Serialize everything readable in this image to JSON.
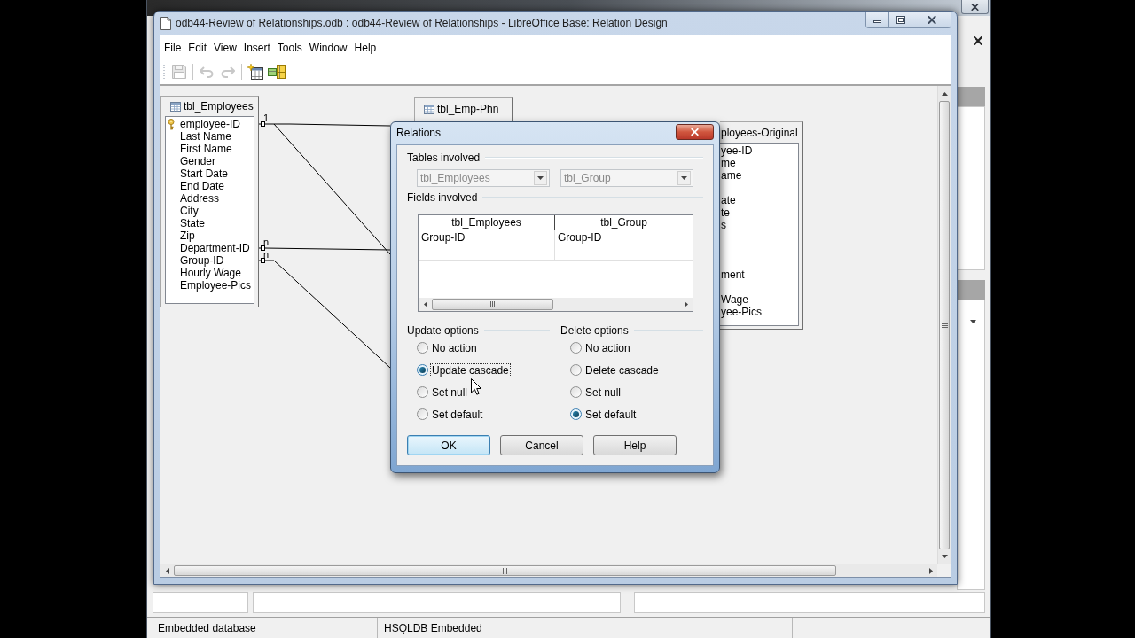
{
  "window": {
    "title": "odb44-Review of Relationships.odb : odb44-Review of Relationships - LibreOffice Base: Relation Design"
  },
  "menu": [
    {
      "label": "File"
    },
    {
      "label": "Edit"
    },
    {
      "label": "View"
    },
    {
      "label": "Insert"
    },
    {
      "label": "Tools"
    },
    {
      "label": "Window"
    },
    {
      "label": "Help"
    }
  ],
  "toolbar": [
    {
      "kind": "save",
      "disabled": true
    },
    {
      "kind": "separator"
    },
    {
      "kind": "undo",
      "disabled": true
    },
    {
      "kind": "redo",
      "disabled": true
    },
    {
      "kind": "separator"
    },
    {
      "kind": "add-tables",
      "disabled": false
    },
    {
      "kind": "new-relation",
      "disabled": false
    }
  ],
  "canvas": {
    "tables": [
      {
        "title": "tbl_Employees",
        "fields": [
          {
            "name": "employee-ID",
            "primary_key": true,
            "cardinality": "1"
          },
          {
            "name": "Last Name",
            "primary_key": false
          },
          {
            "name": "First Name",
            "primary_key": false
          },
          {
            "name": "Gender",
            "primary_key": false
          },
          {
            "name": "Start Date",
            "primary_key": false
          },
          {
            "name": "End Date",
            "primary_key": false
          },
          {
            "name": "Address",
            "primary_key": false
          },
          {
            "name": "City",
            "primary_key": false
          },
          {
            "name": "State",
            "primary_key": false
          },
          {
            "name": "Zip",
            "primary_key": false
          },
          {
            "name": "Department-ID",
            "primary_key": false,
            "cardinality": "n"
          },
          {
            "name": "Group-ID",
            "primary_key": false,
            "cardinality": "n"
          },
          {
            "name": "Hourly Wage",
            "primary_key": false
          },
          {
            "name": "Employee-Pics",
            "primary_key": false
          }
        ]
      },
      {
        "title": "tbl_Emp-Phn"
      },
      {
        "title": "ployees-Original",
        "fields": [
          {
            "kind": "field",
            "name": "yee-ID"
          },
          {
            "kind": "field",
            "name": "me"
          },
          {
            "kind": "field",
            "name": "ame"
          },
          {
            "kind": "covered"
          },
          {
            "kind": "field",
            "name": "ate"
          },
          {
            "kind": "field",
            "name": "te"
          },
          {
            "kind": "field",
            "name": "s"
          },
          {
            "kind": "covered"
          },
          {
            "kind": "covered"
          },
          {
            "kind": "covered"
          },
          {
            "kind": "field",
            "name": "ment"
          },
          {
            "kind": "covered"
          },
          {
            "kind": "field",
            "name": "Wage"
          },
          {
            "kind": "field",
            "name": "yee-Pics"
          }
        ]
      }
    ]
  },
  "dialog": {
    "title": "Relations",
    "tables_involved": {
      "label": "Tables involved",
      "tables": [
        {
          "value": "tbl_Employees",
          "disabled": true
        },
        {
          "value": "tbl_Group",
          "disabled": true
        }
      ]
    },
    "fields_involved": {
      "label": "Fields involved",
      "columns": [
        "tbl_Employees",
        "tbl_Group"
      ],
      "rows": [
        [
          "Group-ID",
          "Group-ID"
        ]
      ]
    },
    "update_options": {
      "label": "Update options",
      "options": [
        {
          "label": "No action",
          "selected": false,
          "focused": false
        },
        {
          "label": "Update cascade",
          "selected": true,
          "focused": true
        },
        {
          "label": "Set null",
          "selected": false,
          "focused": false
        },
        {
          "label": "Set default",
          "selected": false,
          "focused": false
        }
      ]
    },
    "delete_options": {
      "label": "Delete options",
      "options": [
        {
          "label": "No action",
          "selected": false,
          "focused": false
        },
        {
          "label": "Delete cascade",
          "selected": false,
          "focused": false
        },
        {
          "label": "Set null",
          "selected": false,
          "focused": false
        },
        {
          "label": "Set default",
          "selected": true,
          "focused": false
        }
      ]
    },
    "buttons": [
      {
        "label": "OK",
        "default": true
      },
      {
        "label": "Cancel",
        "default": false
      },
      {
        "label": "Help",
        "default": false
      }
    ]
  },
  "status_bar": [
    "Embedded database",
    "HSQLDB Embedded"
  ]
}
